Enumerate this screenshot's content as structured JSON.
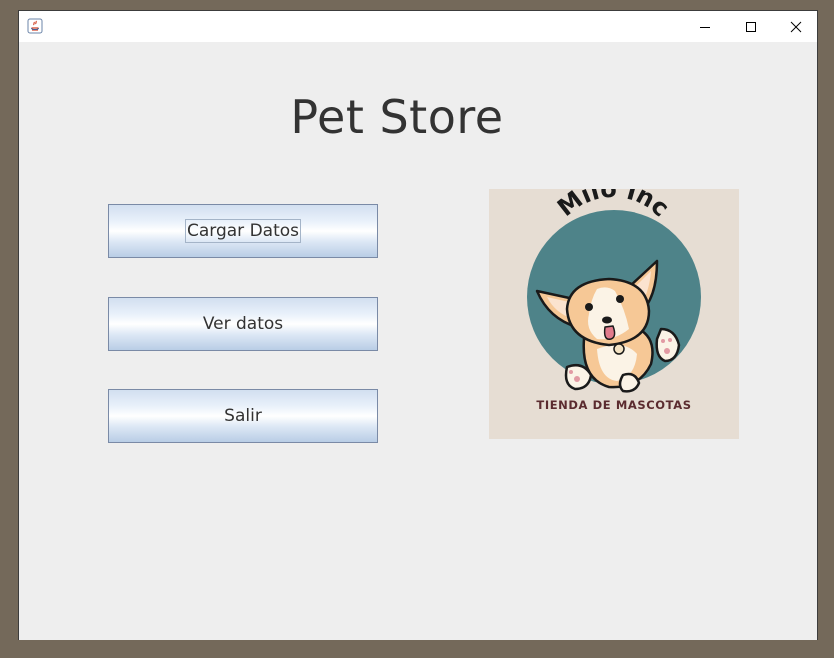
{
  "window": {
    "title": "",
    "controls": {
      "minimize_icon": "minimize-icon",
      "maximize_icon": "maximize-icon",
      "close_icon": "close-icon"
    }
  },
  "main": {
    "title": "Pet Store",
    "buttons": [
      {
        "label": "Cargar Datos"
      },
      {
        "label": "Ver datos"
      },
      {
        "label": "Salir"
      }
    ]
  },
  "logo": {
    "brand": "Milo Inc",
    "tagline": "TIENDA DE MASCOTAS",
    "colors": {
      "background": "#e6ddd3",
      "circle": "#4e8389",
      "text_dark": "#1a1a1a",
      "tagline": "#5b2b2f"
    }
  }
}
